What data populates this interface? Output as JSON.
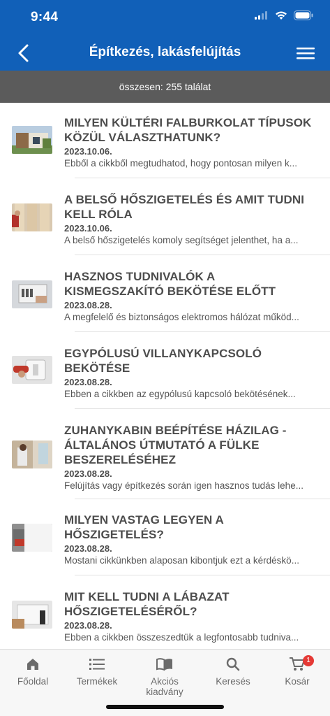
{
  "status_bar": {
    "time": "9:44"
  },
  "header": {
    "title": "Építkezés, lakásfelújítás",
    "bg_color": "#1160b8"
  },
  "results": {
    "summary": "összesen: 255 találat"
  },
  "articles": [
    {
      "title": "MILYEN KÜLTÉRI FALBURKOLAT TÍPUSOK KÖZÜL VÁLASZTHATUNK?",
      "date": "2023.10.06.",
      "excerpt": "Ebből a cikkből megtudhatod, hogy pontosan milyen k...",
      "image": "house-facade-photo"
    },
    {
      "title": "A BELSŐ HŐSZIGETELÉS ÉS AMIT TUDNI KELL RÓLA",
      "date": "2023.10.06.",
      "excerpt": "A belső hőszigetelés komoly segítséget jelenthet, ha a...",
      "image": "insulation-wall-photo"
    },
    {
      "title": "HASZNOS TUDNIVALÓK A KISMEGSZAKÍTÓ BEKÖTÉSE ELŐTT",
      "date": "2023.08.28.",
      "excerpt": "A megfelelő és biztonságos elektromos hálózat működ...",
      "image": "circuit-breaker-photo"
    },
    {
      "title": "EGYPÓLUSÚ VILLANYKAPCSOLÓ BEKÖTÉSE",
      "date": "2023.08.28.",
      "excerpt": "Ebben a cikkben az egypólusú kapcsoló bekötésének...",
      "image": "light-switch-photo"
    },
    {
      "title": "ZUHANYKABIN BEÉPÍTÉSE HÁZILAG - ÁLTALÁNOS ÚTMUTATÓ A FÜLKE BESZERELÉSÉHEZ",
      "date": "2023.08.28.",
      "excerpt": "Felújítás vagy építkezés során igen hasznos tudás lehe...",
      "image": "shower-cabin-photo"
    },
    {
      "title": "MILYEN VASTAG LEGYEN A HŐSZIGETELÉS?",
      "date": "2023.08.28.",
      "excerpt": "Mostani cikkünkben alaposan kibontjuk ezt a kérdéskö...",
      "image": "insulation-board-photo"
    },
    {
      "title": "MIT KELL TUDNI A LÁBAZAT HŐSZIGETELÉSÉRŐL?",
      "date": "2023.08.28.",
      "excerpt": "Ebben a cikkben összeszedtük a legfontosabb tudniva...",
      "image": "plinth-insulation-photo"
    }
  ],
  "tabbar": {
    "items": [
      {
        "label": "Főoldal",
        "icon": "home-icon"
      },
      {
        "label": "Termékek",
        "icon": "list-icon"
      },
      {
        "label": "Akciós kiadvány",
        "icon": "book-icon"
      },
      {
        "label": "Keresés",
        "icon": "search-icon"
      },
      {
        "label": "Kosár",
        "icon": "cart-icon"
      }
    ],
    "cart_count": "1"
  }
}
